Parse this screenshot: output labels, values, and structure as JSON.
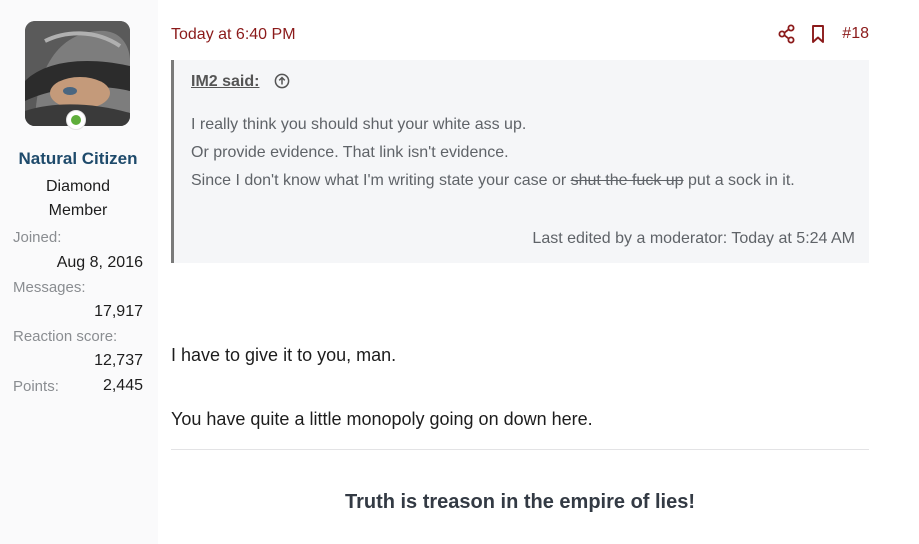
{
  "user": {
    "name": "Natural Citizen",
    "title": "Diamond Member",
    "stats": [
      {
        "label": "Joined:",
        "value": "Aug 8, 2016"
      },
      {
        "label": "Messages:",
        "value": "17,917"
      },
      {
        "label": "Reaction score:",
        "value": "12,737"
      },
      {
        "label": "Points:",
        "value": "2,445"
      }
    ]
  },
  "post": {
    "date": "Today at 6:40 PM",
    "number": "#18",
    "quote": {
      "author": "IM2 said:",
      "line1": "I really think you should shut your white ass up.",
      "line2": "Or provide evidence. That link isn't evidence.",
      "line3_pre": "Since I don't know what I'm writing state your case or ",
      "line3_strike": "shut the fuck up",
      "line3_post": " put a sock in it.",
      "edited": "Last edited by a moderator: Today at 5:24 AM"
    },
    "body": [
      "I have to give it to you, man.",
      "You have quite a little monopoly going on down here."
    ],
    "signature": "Truth is treason in the empire of lies!"
  },
  "icons": [
    "share-icon",
    "bookmark-icon",
    "arrow-up-circle-icon"
  ],
  "colors": {
    "accent": "#8b1a1a",
    "username": "#1e4a6b",
    "online": "#5fae3b"
  }
}
